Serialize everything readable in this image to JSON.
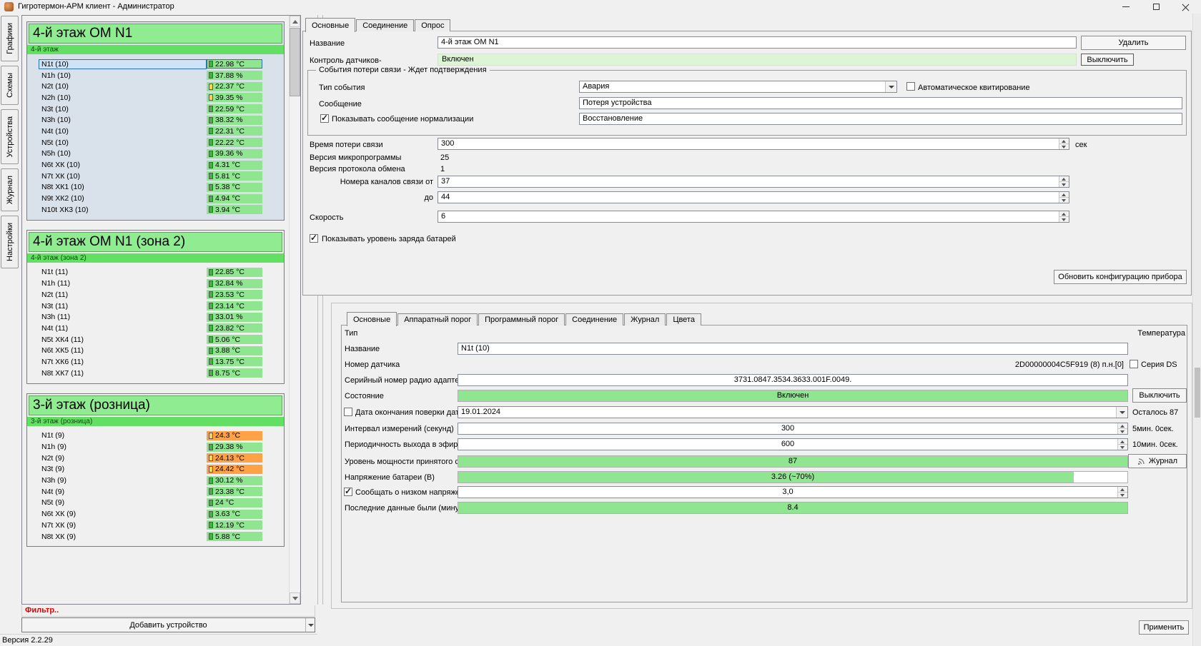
{
  "colors": {
    "ok_green": "#90e690",
    "pale_green": "#def5d5",
    "header_green": "#90ec90",
    "subtitle_green": "#63df63",
    "alarm_orange": "#ffa245",
    "warn_yellow": "#ffd24a",
    "selected_blue": "#2f6fb2",
    "filter_red": "#e00000"
  },
  "window": {
    "title": "Гигротермон-АРМ клиент - Администратор",
    "status": "Версия 2.2.29"
  },
  "side_tabs": [
    "Графики",
    "Схемы",
    "Устройства",
    "Журнал",
    "Настройки"
  ],
  "device_list": {
    "filter": "Фильтр..",
    "add_device": "Добавить устройство",
    "groups": [
      {
        "title": "4-й этаж ОМ N1",
        "subtitle": "4-й этаж",
        "tinted": true,
        "sensors": [
          {
            "name": "N1t (10)",
            "value": "22.98 °C",
            "state": "selected"
          },
          {
            "name": "N1h (10)",
            "value": "37.88 %",
            "state": "ok"
          },
          {
            "name": "N2t (10)",
            "value": "22.37 °C",
            "state": "warn"
          },
          {
            "name": "N2h (10)",
            "value": "39.35 %",
            "state": "warn"
          },
          {
            "name": "N3t (10)",
            "value": "22.59 °C",
            "state": "ok"
          },
          {
            "name": "N3h (10)",
            "value": "38.32 %",
            "state": "ok"
          },
          {
            "name": "N4t (10)",
            "value": "22.31 °C",
            "state": "ok"
          },
          {
            "name": "N5t (10)",
            "value": "22.22 °C",
            "state": "ok"
          },
          {
            "name": "N5h (10)",
            "value": "39.36 %",
            "state": "ok"
          },
          {
            "name": "N6t ХК (10)",
            "value": "4.31 °C",
            "state": "ok"
          },
          {
            "name": "N7t ХК (10)",
            "value": "5.81 °C",
            "state": "ok"
          },
          {
            "name": "N8t ХК1 (10)",
            "value": "5.38 °C",
            "state": "ok"
          },
          {
            "name": "N9t ХК2 (10)",
            "value": "4.94 °C",
            "state": "ok"
          },
          {
            "name": "N10t ХК3 (10)",
            "value": "3.94 °C",
            "state": "ok"
          }
        ]
      },
      {
        "title": "4-й этаж ОМ N1 (зона 2)",
        "subtitle": "4-й этаж (зона 2)",
        "tinted": false,
        "sensors": [
          {
            "name": "N1t (11)",
            "value": "22.85 °C",
            "state": "ok"
          },
          {
            "name": "N1h (11)",
            "value": "32.84 %",
            "state": "ok"
          },
          {
            "name": "N2t (11)",
            "value": "23.53 °C",
            "state": "ok"
          },
          {
            "name": "N3t (11)",
            "value": "23.14 °C",
            "state": "ok"
          },
          {
            "name": "N3h (11)",
            "value": "33.01 %",
            "state": "ok"
          },
          {
            "name": "N4t (11)",
            "value": "23.82 °C",
            "state": "ok"
          },
          {
            "name": "N5t ХК4 (11)",
            "value": "5.06 °C",
            "state": "ok"
          },
          {
            "name": "N6t ХК5 (11)",
            "value": "3.88 °C",
            "state": "ok"
          },
          {
            "name": "N7t ХК6 (11)",
            "value": "13.75 °C",
            "state": "ok"
          },
          {
            "name": "N8t ХК7 (11)",
            "value": "8.75 °C",
            "state": "ok"
          }
        ]
      },
      {
        "title": "3-й этаж (розница)",
        "subtitle": "3-й этаж (розница)",
        "tinted": false,
        "sensors": [
          {
            "name": "N1t (9)",
            "value": "24.3 °C",
            "state": "alarm"
          },
          {
            "name": "N1h (9)",
            "value": "29.38 %",
            "state": "ok"
          },
          {
            "name": "N2t (9)",
            "value": "24.13 °C",
            "state": "alarm"
          },
          {
            "name": "N3t (9)",
            "value": "24.42 °C",
            "state": "alarm"
          },
          {
            "name": "N3h (9)",
            "value": "30.12 %",
            "state": "ok"
          },
          {
            "name": "N4t (9)",
            "value": "23.38 °C",
            "state": "ok"
          },
          {
            "name": "N5t (9)",
            "value": "24 °C",
            "state": "ok"
          },
          {
            "name": "N6t ХК (9)",
            "value": "3.63 °C",
            "state": "ok"
          },
          {
            "name": "N7t ХК (9)",
            "value": "12.19 °C",
            "state": "ok"
          },
          {
            "name": "N8t ХК (9)",
            "value": "5.88 °C",
            "state": "ok"
          }
        ]
      }
    ]
  },
  "device_panel": {
    "tabs": [
      "Основные",
      "Соединение",
      "Опрос"
    ],
    "name_label": "Название",
    "name_value": "4-й этаж ОМ N1",
    "delete_button": "Удалить",
    "control_label": "Контроль датчиков-",
    "control_value": "Включен",
    "disable_button": "Выключить",
    "loss_group": {
      "title": "События потери связи - Ждет подтверждения",
      "event_type_label": "Тип события",
      "event_type_value": "Авария",
      "auto_ack_label": "Автоматическое квитирование",
      "message_label": "Сообщение",
      "message_value": "Потеря устройства",
      "show_norm_label": "Показывать сообщение нормализации",
      "norm_value": "Восстановление"
    },
    "loss_time_label": "Время потери связи",
    "loss_time_value": "300",
    "loss_time_unit": "сек",
    "fw_label": "Версия микропрограммы",
    "fw_value": "25",
    "proto_label": "Версия протокола обмена",
    "proto_value": "1",
    "chan_from_label": "Номера каналов связи от",
    "chan_from_value": "37",
    "chan_to_label": "до",
    "chan_to_value": "44",
    "speed_label": "Скорость",
    "speed_value": "6",
    "battery_label": "Показывать уровень заряда батарей",
    "update_config_button": "Обновить конфигурацию прибора"
  },
  "sensor_panel": {
    "tabs": [
      "Основные",
      "Аппаратный порог",
      "Программный порог",
      "Соединение",
      "Журнал",
      "Цвета"
    ],
    "type_label": "Тип",
    "type_value": "Температура",
    "name_label": "Название",
    "name_value": "N1t (10)",
    "sensor_num_label": "Номер датчика",
    "sensor_num_value": "2D00000004C5F919 (8) п.н.[0]",
    "ds_label": "Серия DS",
    "radio_label": "Серийный номер радио адаптера",
    "radio_value": "3731.0847.3534.3633.001F.0049.",
    "state_label": "Состояние",
    "state_value": "Включен",
    "disable_button": "Выключить",
    "verify_label": "Дата окончания поверки датчика",
    "verify_value": "19.01.2024",
    "verify_left": "Осталось 87",
    "interval_label": "Интервал измерений (секунд)",
    "interval_value": "300",
    "interval_hint": "5мин. 0сек.",
    "air_label": "Периодичность выхода в эфир (секунд)",
    "air_value": "600",
    "air_hint": "10мин. 0сек.",
    "signal_label": "Уровень мощности принятого сигнала",
    "signal_value": "87",
    "journal_button": "Журнал",
    "voltage_label": "Напряжение батареи (В)",
    "voltage_value": "3.26 (~70%)",
    "low_batt_label": "Сообщать о низком напряжении батареи",
    "low_batt_value": "3,0",
    "last_data_label": "Последние данные были (минут назад)",
    "last_data_value": "8.4"
  },
  "apply_button": "Применить"
}
